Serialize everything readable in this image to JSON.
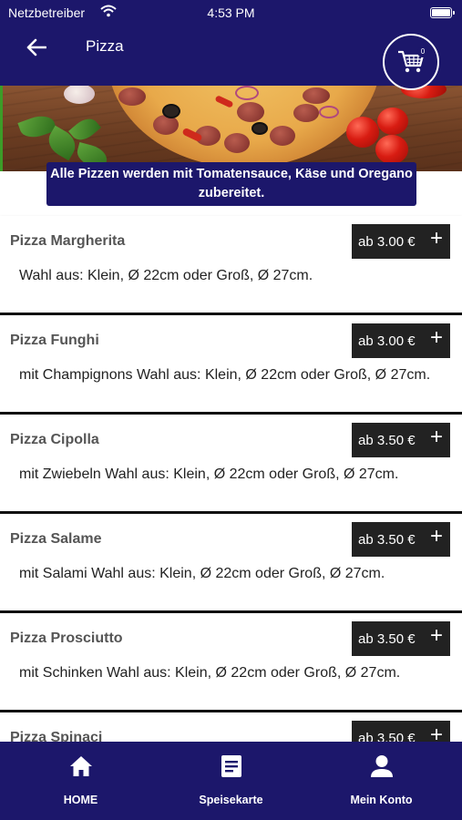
{
  "status_bar": {
    "carrier": "Netzbetreiber",
    "time": "4:53 PM"
  },
  "header": {
    "title": "Pizza",
    "cart_count": "0"
  },
  "info_text": "Alle Pizzen werden mit Tomatensauce, Käse und Oregano zubereitet.",
  "items": [
    {
      "name": "Pizza Margherita",
      "price": "ab 3.00 €",
      "description": "Wahl aus: Klein, Ø 22cm oder Groß, Ø 27cm."
    },
    {
      "name": "Pizza Funghi",
      "price": "ab 3.00 €",
      "description": "mit Champignons Wahl aus: Klein, Ø 22cm oder Groß, Ø 27cm."
    },
    {
      "name": "Pizza Cipolla",
      "price": "ab 3.50 €",
      "description": "mit Zwiebeln Wahl aus: Klein, Ø 22cm oder Groß, Ø 27cm."
    },
    {
      "name": "Pizza Salame",
      "price": "ab 3.50 €",
      "description": "mit Salami Wahl aus: Klein, Ø 22cm oder Groß, Ø 27cm."
    },
    {
      "name": "Pizza Prosciutto",
      "price": "ab 3.50 €",
      "description": "mit Schinken Wahl aus: Klein, Ø 22cm oder Groß, Ø 27cm."
    },
    {
      "name": "Pizza Spinaci",
      "price": "ab 3.50 €",
      "description": ""
    }
  ],
  "add_symbol": "+",
  "tabbar": {
    "home": "HOME",
    "menu": "Speisekarte",
    "account": "Mein Konto"
  },
  "colors": {
    "primary": "#1c176b",
    "price_button": "#222222"
  },
  "icons": {
    "back": "arrow-left-icon",
    "cart": "shopping-cart-icon",
    "home": "home-icon",
    "menu": "document-list-icon",
    "account": "person-icon"
  }
}
